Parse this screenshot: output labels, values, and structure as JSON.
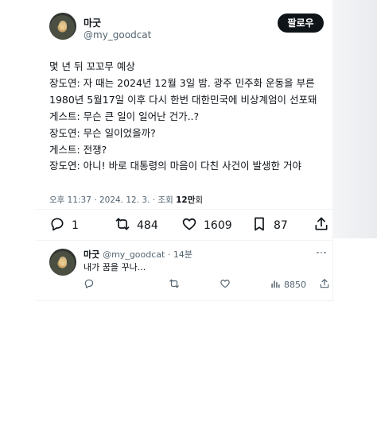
{
  "author": {
    "display_name": "마굿",
    "handle": "@my_goodcat"
  },
  "follow_label": "팔로우",
  "tweet": {
    "lines": [
      "몇 년 뒤 꼬꼬무 예상",
      "장도연: 자 때는 2024년 12월 3일 밤. 광주 민주화 운동을 부른",
      "1980년 5월17일 이후 다시 한번 대한민국에 비상계엄이 선포돼",
      "게스트: 무슨 큰 일이 일어난 건가..?",
      "장도연: 무슨 일이었을까?",
      "게스트: 전쟁?",
      "장도연: 아니! 바로 대통령의 마음이 다친 사건이 발생한 거야"
    ],
    "time": "오후 11:37",
    "date": "2024. 12. 3.",
    "views_label": "조회",
    "views_count": "12만",
    "views_unit": "회"
  },
  "actions": {
    "replies": "1",
    "retweets": "484",
    "likes": "1609",
    "bookmarks": "87"
  },
  "reply": {
    "display_name": "마굿",
    "handle": "@my_goodcat",
    "age": "14분",
    "text": "내가 꿈을 꾸나...",
    "views": "8850"
  }
}
